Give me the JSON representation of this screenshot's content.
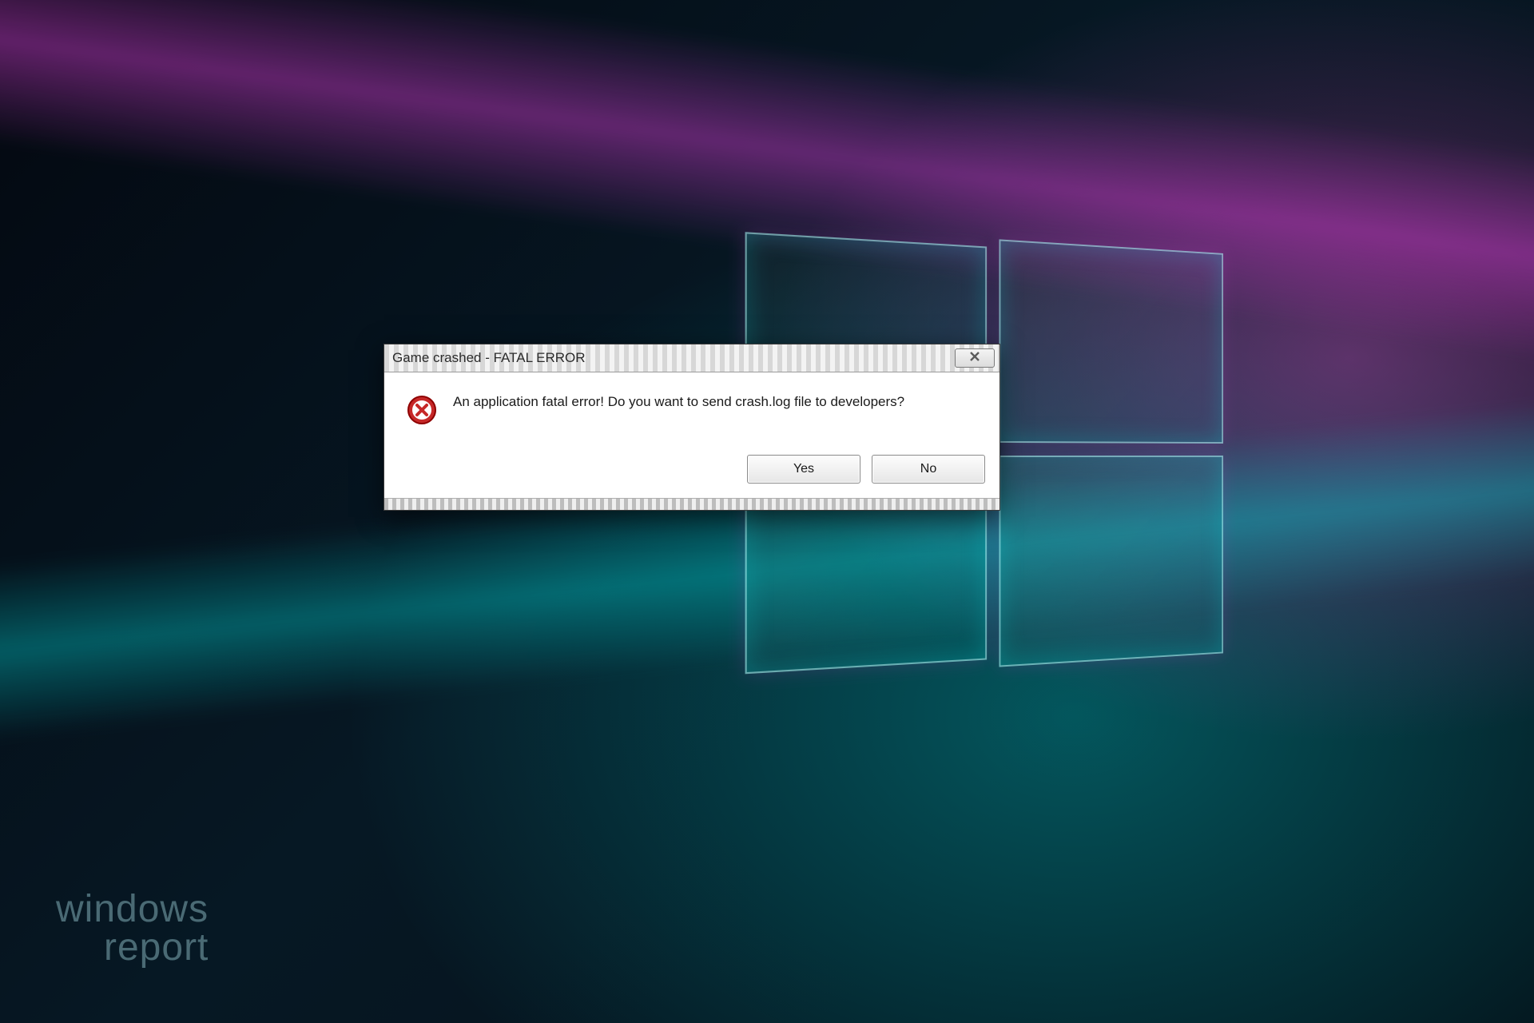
{
  "dialog": {
    "title": "Game crashed - FATAL ERROR",
    "message": "An application fatal error! Do you want to send crash.log file to developers?",
    "buttons": {
      "yes": "Yes",
      "no": "No"
    },
    "close_glyph": "×",
    "icon": "error-circle-icon"
  },
  "watermark": {
    "line1": "windows",
    "line2": "report"
  }
}
